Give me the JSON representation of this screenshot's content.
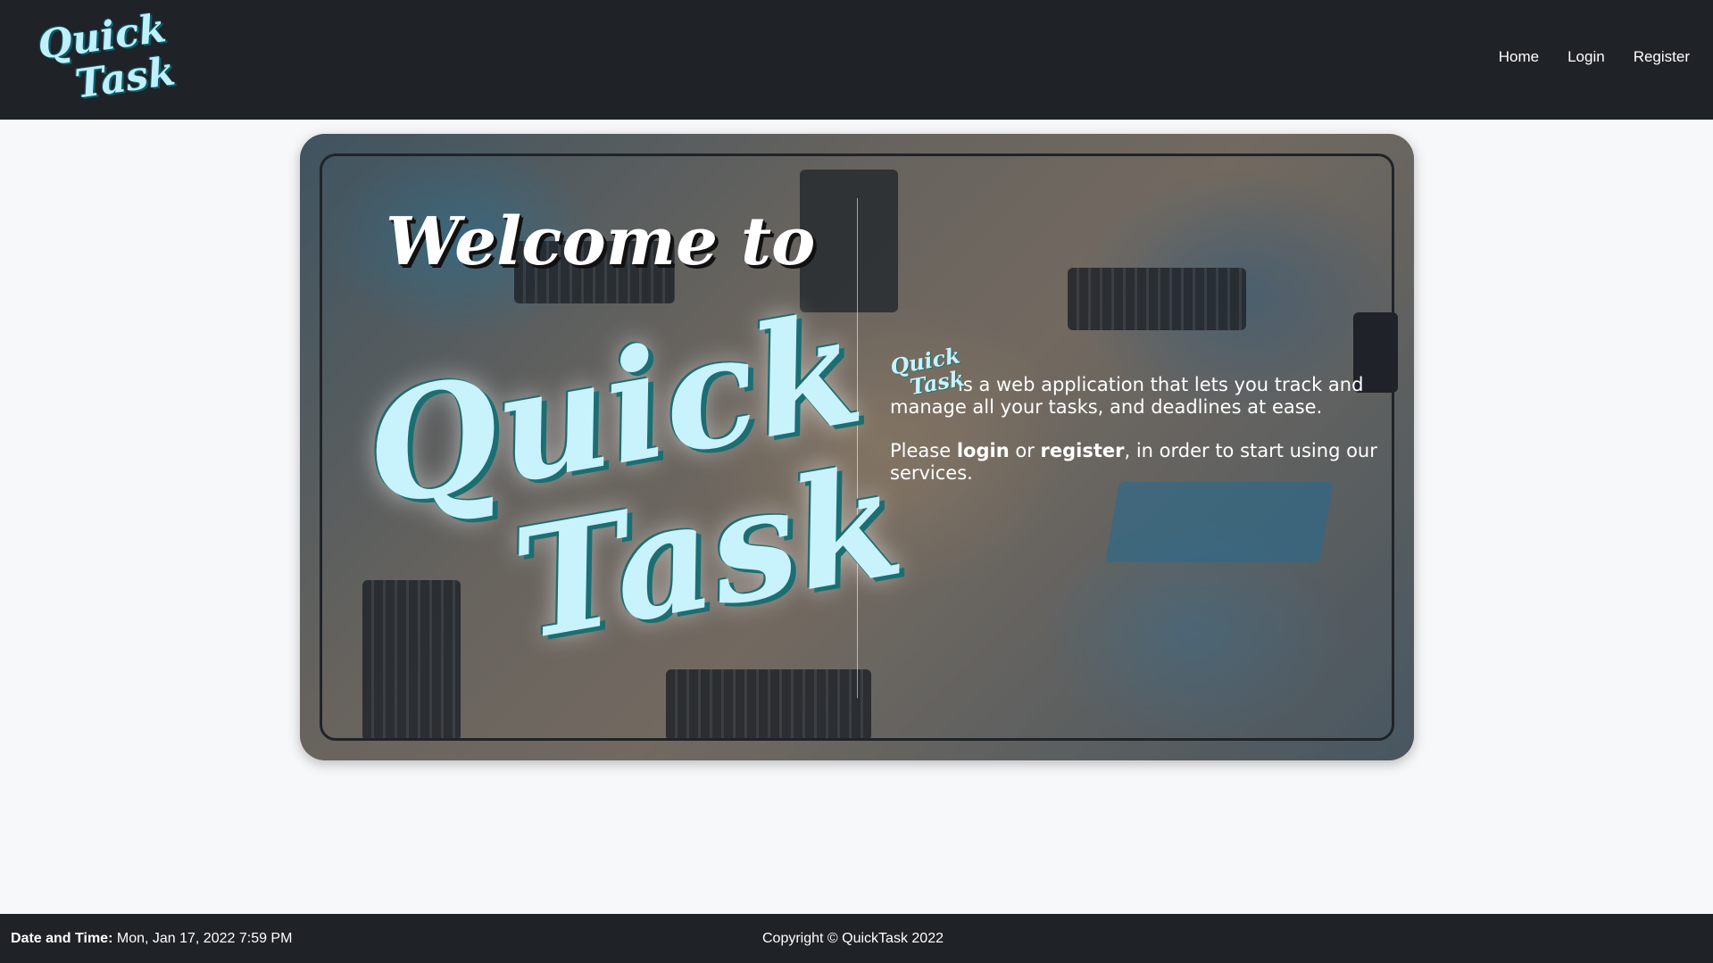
{
  "brand": {
    "logo_word1": "Quick",
    "logo_word2": "Task",
    "logo_color": "#bff0fb"
  },
  "nav": {
    "items": [
      {
        "label": "Home"
      },
      {
        "label": "Login"
      },
      {
        "label": "Register"
      }
    ]
  },
  "hero": {
    "welcome": "Welcome to",
    "title_word1": "Quick",
    "title_word2": "Task",
    "desc_rest": "is a web application that lets you track and manage all your tasks, and deadlines at ease.",
    "cta_prefix": "Please",
    "cta_login": "login",
    "cta_or": "or",
    "cta_register": "register",
    "cta_suffix": ", in order to start using our services."
  },
  "footer": {
    "datetime_label": "Date and Time:",
    "datetime_value": "Mon, Jan 17, 2022 7:59 PM",
    "copyright": "Copyright © QuickTask 2022"
  },
  "colors": {
    "navbar_bg": "#1f2328",
    "page_bg": "#f7f8fa",
    "accent_cyan": "#c8f3fc"
  }
}
